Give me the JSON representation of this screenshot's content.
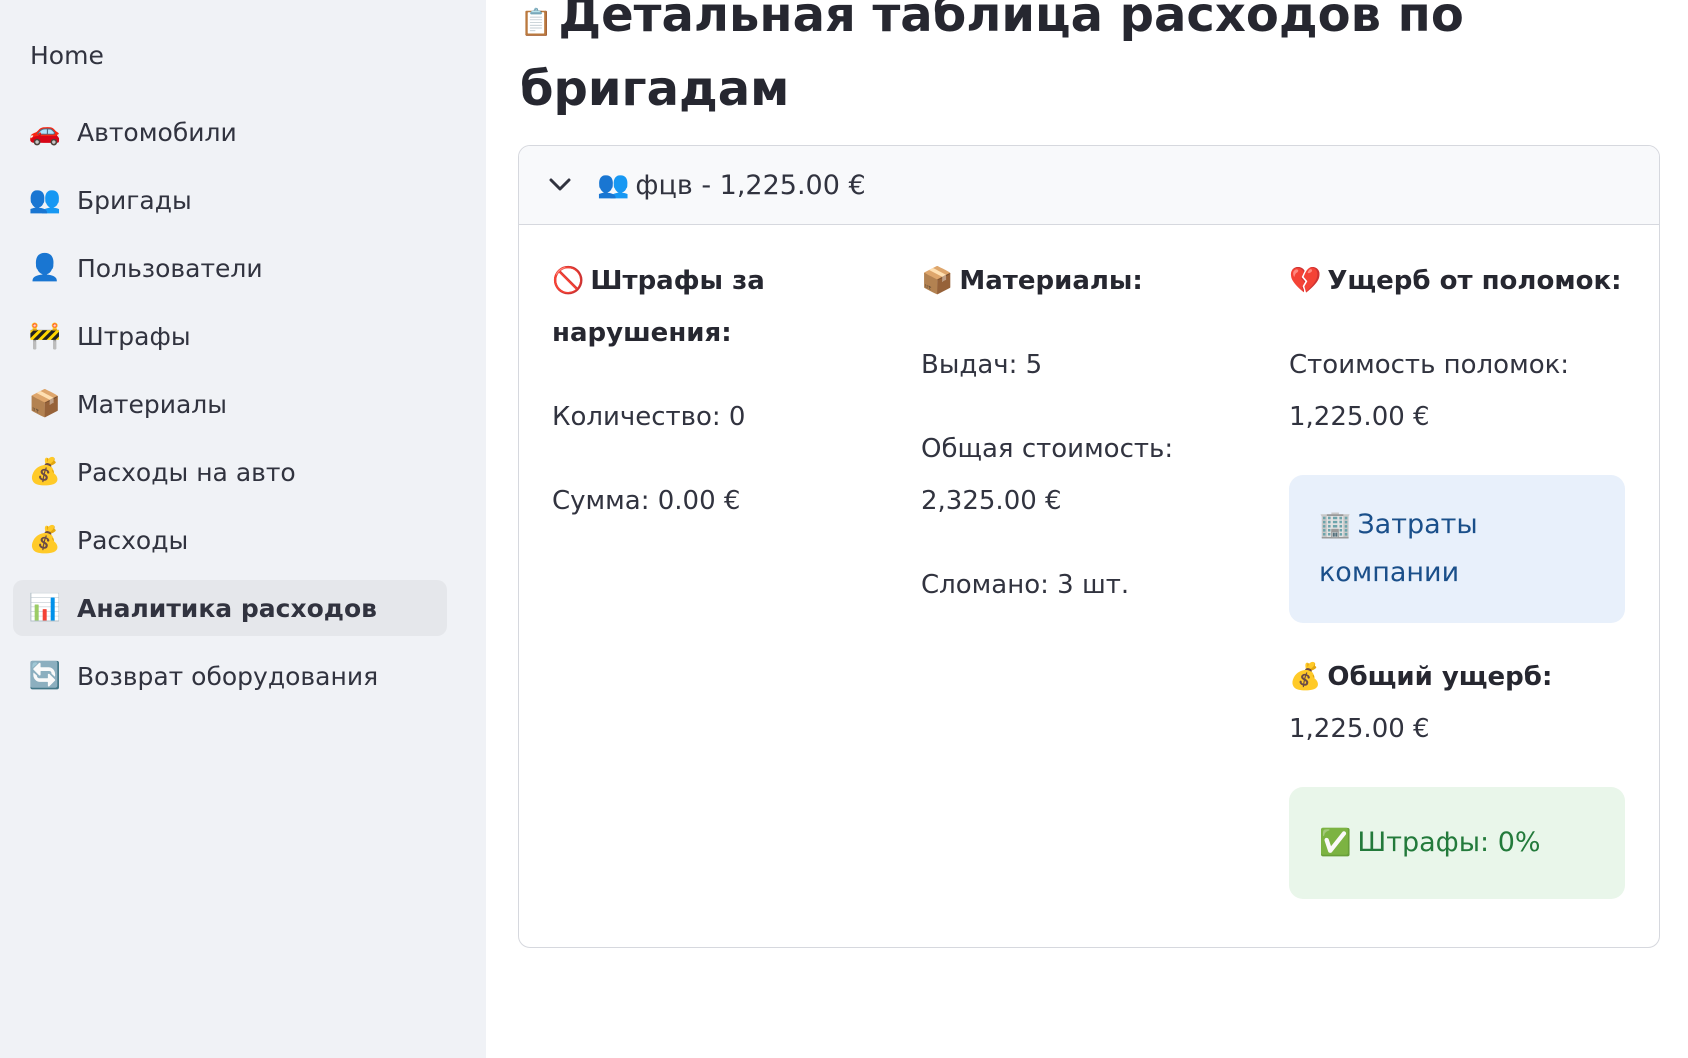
{
  "sidebar": {
    "home": "Home",
    "items": [
      {
        "icon": "🚗",
        "label": "Автомобили",
        "active": false
      },
      {
        "icon": "👥",
        "label": "Бригады",
        "active": false
      },
      {
        "icon": "👤",
        "label": "Пользователи",
        "active": false
      },
      {
        "icon": "🚧",
        "label": "Штрафы",
        "active": false
      },
      {
        "icon": "📦",
        "label": "Материалы",
        "active": false
      },
      {
        "icon": "💰",
        "label": "Расходы на авто",
        "active": false
      },
      {
        "icon": "💰",
        "label": "Расходы",
        "active": false
      },
      {
        "icon": "📊",
        "label": "Аналитика расходов",
        "active": true
      },
      {
        "icon": "🔄",
        "label": "Возврат оборудования",
        "active": false
      }
    ]
  },
  "main": {
    "title_icon": "📋",
    "title": "Детальная таблица расходов по бригадам",
    "expander": {
      "icon": "👥",
      "label": "фцв - 1,225.00 €",
      "fines": {
        "icon": "🚫",
        "header": "Штрафы за нарушения:",
        "count": "Количество: 0",
        "sum": "Сумма: 0.00 €"
      },
      "materials": {
        "icon": "📦",
        "header": "Материалы:",
        "issued": "Выдач: 5",
        "total_cost": "Общая стоимость: 2,325.00 €",
        "broken": "Сломано: 3 шт."
      },
      "damage": {
        "icon": "💔",
        "header": "Ущерб от поломок:",
        "breakage_cost": "Стоимость поломок: 1,225.00 €",
        "company_icon": "🏢",
        "company_costs": "Затраты компании",
        "total_icon": "💰",
        "total_header": "Общий ущерб:",
        "total_value": "1,225.00 €",
        "fines_icon": "✅",
        "fines_pct": "Штрафы: 0%"
      }
    }
  }
}
